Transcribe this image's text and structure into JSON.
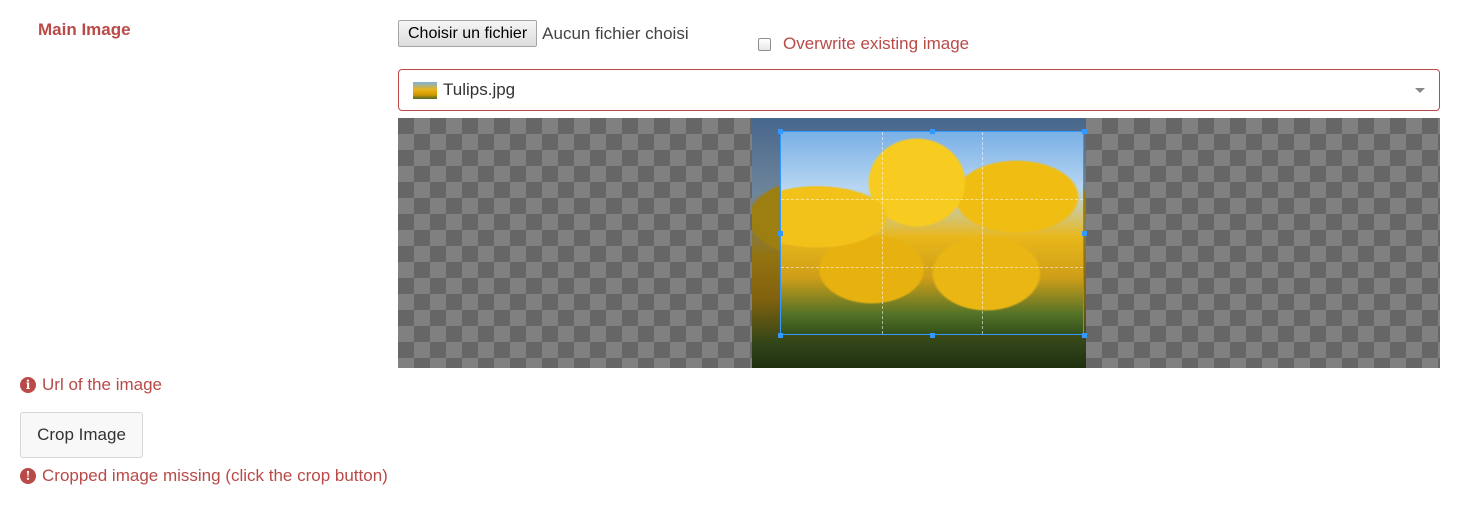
{
  "form": {
    "field_label": "Main Image",
    "file_button_label": "Choisir un fichier",
    "file_status": "Aucun fichier choisi",
    "overwrite_label": "Overwrite existing image",
    "overwrite_checked": false,
    "selected_image": "Tulips.jpg",
    "url_message": "Url of the image",
    "crop_button_label": "Crop Image",
    "missing_message": "Cropped image missing (click the crop button)"
  },
  "icons": {
    "info": "info-circle-icon",
    "warning": "exclamation-circle-icon",
    "dropdown": "chevron-down-icon"
  },
  "colors": {
    "error": "#b94a48",
    "crop_accent": "#3399ff"
  }
}
